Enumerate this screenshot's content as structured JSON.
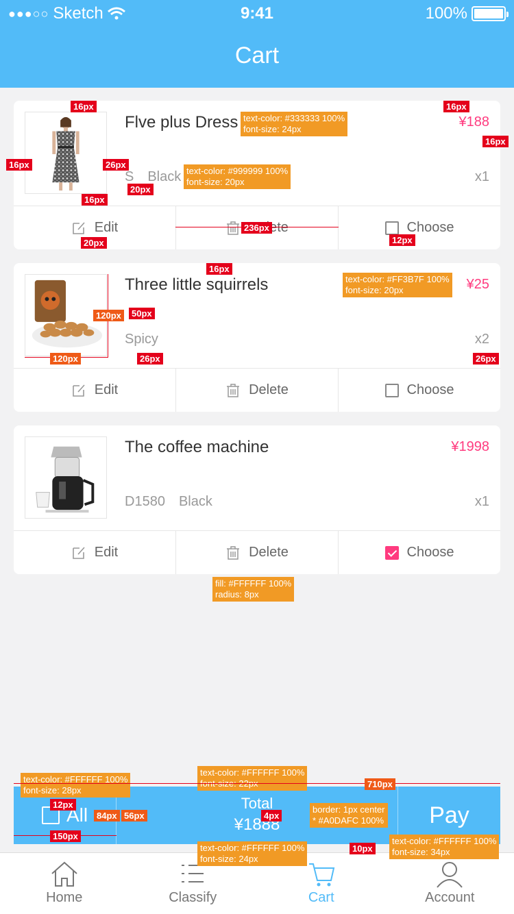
{
  "status_bar": {
    "carrier": "Sketch",
    "time": "9:41",
    "battery": "100%"
  },
  "header": {
    "title": "Cart"
  },
  "items": [
    {
      "name": "Flve plus Dress",
      "spec": [
        "S",
        "Black"
      ],
      "price": "¥188",
      "qty": "x1",
      "image": "dress",
      "chosen": false
    },
    {
      "name": "Three little squirrels",
      "spec": [
        "Spicy"
      ],
      "price": "¥25",
      "qty": "x2",
      "image": "nuts",
      "chosen": false
    },
    {
      "name": "The coffee machine",
      "spec": [
        "D1580",
        "Black"
      ],
      "price": "¥1998",
      "qty": "x1",
      "image": "coffee-machine",
      "chosen": true
    }
  ],
  "actions": {
    "edit": "Edit",
    "delete": "Delete",
    "choose": "Choose"
  },
  "checkout": {
    "all_label": "All",
    "total_label": "Total",
    "total_amount": "¥1888",
    "pay_label": "Pay"
  },
  "tabs": [
    {
      "label": "Home",
      "icon": "home-icon",
      "active": false
    },
    {
      "label": "Classify",
      "icon": "list-icon",
      "active": false
    },
    {
      "label": "Cart",
      "icon": "cart-icon",
      "active": true
    },
    {
      "label": "Account",
      "icon": "person-icon",
      "active": false
    }
  ],
  "colors": {
    "primary": "#52bbf8",
    "price": "#FF3B7F",
    "title_text": "#333333",
    "spec_text": "#999999",
    "card_fill": "#FFFFFF",
    "divider_border": "#A0DAFC"
  },
  "annotations": {
    "title_style": [
      "text-color: #333333 100%",
      "font-size: 24px"
    ],
    "spec_style": [
      "text-color: #999999 100%",
      "font-size: 20px"
    ],
    "price_style": [
      "text-color: #FF3B7F 100%",
      "font-size: 20px"
    ],
    "card_style": [
      "fill: #FFFFFF 100%",
      "radius: 8px"
    ],
    "all_style": [
      "text-color: #FFFFFF 100%",
      "font-size: 28px"
    ],
    "total_style": [
      "text-color: #FFFFFF 100%",
      "font-size: 22px"
    ],
    "amount_style": [
      "text-color: #FFFFFF 100%",
      "font-size: 24px"
    ],
    "border_style": [
      "border: 1px center",
      "* #A0DAFC 100%"
    ],
    "pay_style": [
      "text-color: #FFFFFF 100%",
      "font-size: 34px"
    ],
    "measures": {
      "m16": "16px",
      "m26": "26px",
      "m20": "20px",
      "m12": "12px",
      "m236": "236px",
      "m120": "120px",
      "m50": "50px",
      "m710": "710px",
      "m150": "150px",
      "m84": "84px",
      "m56": "56px",
      "m4": "4px",
      "m10": "10px"
    }
  }
}
